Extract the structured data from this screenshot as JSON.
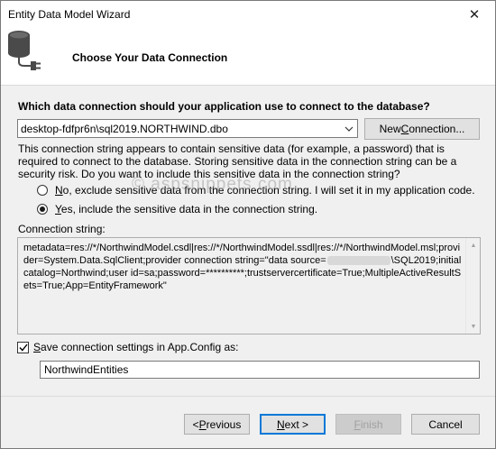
{
  "window": {
    "title": "Entity Data Model Wizard",
    "close_glyph": "✕"
  },
  "header": {
    "icon": "database-plug-icon",
    "step_title": "Choose Your Data Connection"
  },
  "connection": {
    "question": "Which data connection should your application use to connect to the database?",
    "selected": "desktop-fdfpr6n\\sql2019.NORTHWIND.dbo",
    "new_connection_prefix": "New ",
    "new_connection_accel": "C",
    "new_connection_suffix": "onnection..."
  },
  "sensitive": {
    "message": "This connection string appears to contain sensitive data (for example, a password) that is required to connect to the database. Storing sensitive data in the connection string can be a security risk. Do you want to include this sensitive data in the connection string?",
    "option_exclude_accel": "N",
    "option_exclude_rest": "o, exclude sensitive data from the connection string. I will set it in my application code.",
    "option_include_accel": "Y",
    "option_include_rest": "es, include the sensitive data in the connection string.",
    "selected": "include"
  },
  "connection_string": {
    "label": "Connection string:",
    "before_redaction": "metadata=res://*/NorthwindModel.csdl|res://*/NorthwindModel.ssdl|res://*/NorthwindModel.msl;provider=System.Data.SqlClient;provider connection string=\"data source=",
    "after_redaction": "\\SQL2019;initial catalog=Northwind;user id=sa;password=**********;trustservercertificate=True;MultipleActiveResultSets=True;App=EntityFramework\""
  },
  "save_config": {
    "checked": true,
    "label_accel": "S",
    "label_rest": "ave connection settings in App.Config as:",
    "value": "NorthwindEntities"
  },
  "buttons": {
    "previous_prefix": "< ",
    "previous_accel": "P",
    "previous_rest": "revious",
    "next_accel": "N",
    "next_rest": "ext >",
    "finish_accel": "F",
    "finish_rest": "inish",
    "cancel": "Cancel"
  },
  "watermark": "© aspsnippets.com",
  "colors": {
    "accent": "#0078d7",
    "icon": "#4a4a4a"
  }
}
